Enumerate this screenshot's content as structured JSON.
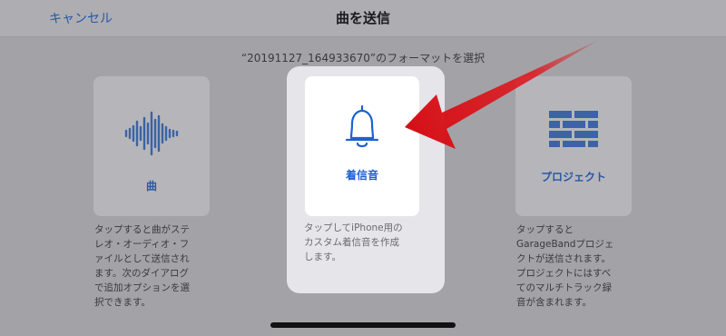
{
  "nav": {
    "cancel_label": "キャンセル",
    "title": "曲を送信"
  },
  "subtitle": "“20191127_164933670”のフォーマットを選択",
  "options": [
    {
      "label": "曲",
      "icon": "waveform-icon",
      "description": "タップすると曲がステ\nレオ・オーディオ・フ\nァイルとして送信され\nます。次のダイアログ\nで追加オプションを選\n択できます。"
    },
    {
      "label": "着信音",
      "icon": "bell-icon",
      "description": "タップしてiPhone用の\nカスタム着信音を作成\nします。"
    },
    {
      "label": "プロジェクト",
      "icon": "brick-wall-icon",
      "description": "タップすると\nGarageBandプロジェ\nクトが送信されます。\nプロジェクトにはすべ\nてのマルチトラック録\n音が含まれます。"
    }
  ],
  "colors": {
    "accent": "#1e62d0",
    "dim_accent": "#2a56a8",
    "arrow": "#e0141b"
  }
}
